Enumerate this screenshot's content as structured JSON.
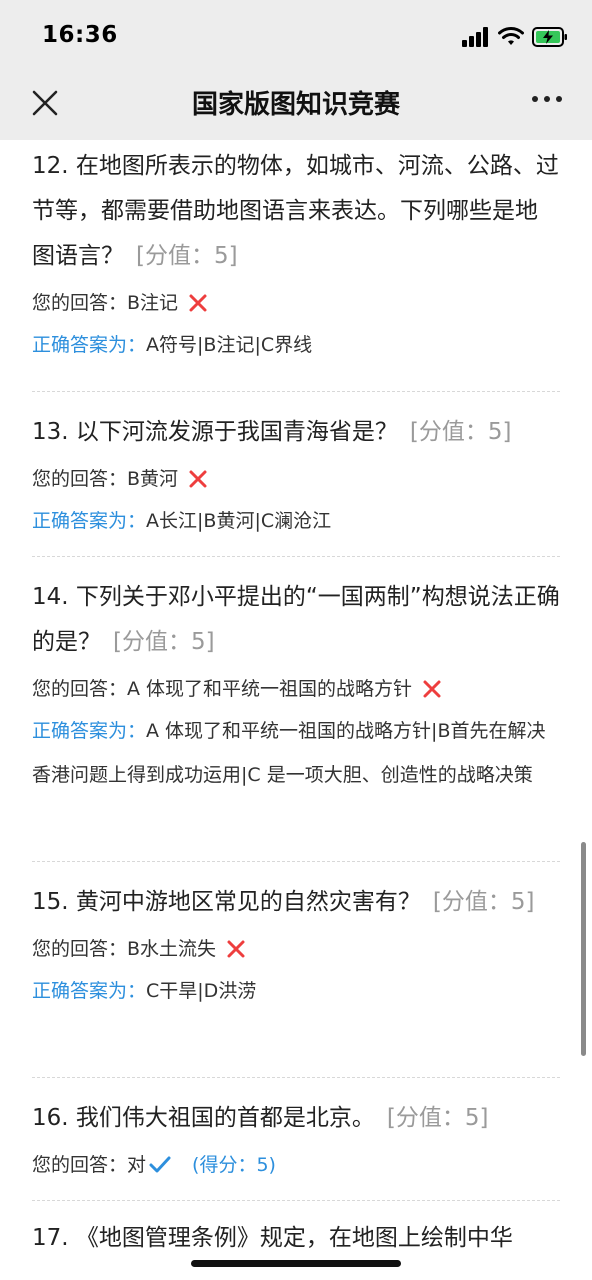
{
  "status": {
    "time": "16:36"
  },
  "nav": {
    "title": "国家版图知识竞赛"
  },
  "answer_label": "您的回答：",
  "correct_label": "正确答案为：",
  "questions": [
    {
      "title": "12. 在地图所表示的物体，如城市、河流、公路、过节等，都需要借助地图语言来表达。下列哪些是地图语言？",
      "score": "[分值：5]",
      "answer": "B注记",
      "correct": "A符号|B注记|C界线"
    },
    {
      "title": "13. 以下河流发源于我国青海省是？",
      "score": "[分值：5]",
      "answer": "B黄河",
      "correct": "A长江|B黄河|C澜沧江"
    },
    {
      "title": "14. 下列关于邓小平提出的“一国两制”构想说法正确的是？",
      "score": "[分值：5]",
      "answer": "A 体现了和平统一祖国的战略方针",
      "correct": "A 体现了和平统一祖国的战略方针|B首先在解决香港问题上得到成功运用|C 是一项大胆、创造性的战略决策"
    },
    {
      "title": "15. 黄河中游地区常见的自然灾害有？",
      "score": "[分值：5]",
      "answer": "B水土流失",
      "correct": "C干旱|D洪涝"
    },
    {
      "title": "16. 我们伟大祖国的首都是北京。",
      "score": "[分值：5]",
      "answer": "对",
      "gained": "(得分：5)"
    },
    {
      "title": "17. 《地图管理条例》规定，在地图上绘制中华"
    }
  ]
}
